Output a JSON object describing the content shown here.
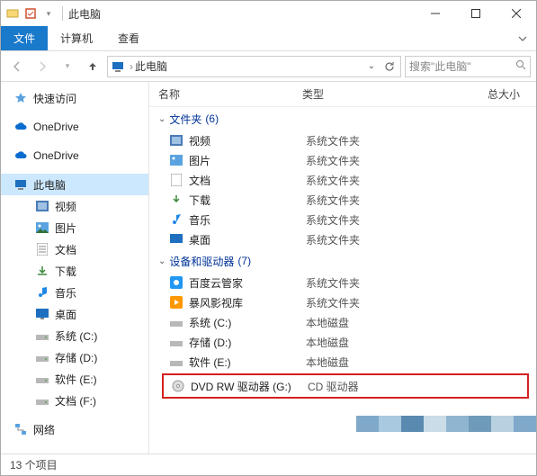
{
  "titlebar": {
    "title": "此电脑"
  },
  "ribbon": {
    "file": "文件",
    "computer": "计算机",
    "view": "查看"
  },
  "address": {
    "location": "此电脑"
  },
  "search": {
    "placeholder": "搜索\"此电脑\""
  },
  "sidebar": {
    "quick_access": "快速访问",
    "onedrive1": "OneDrive",
    "onedrive2": "OneDrive",
    "this_pc": "此电脑",
    "videos": "视频",
    "pictures": "图片",
    "documents": "文档",
    "downloads": "下载",
    "music": "音乐",
    "desktop": "桌面",
    "system_c": "系统 (C:)",
    "storage_d": "存储 (D:)",
    "software_e": "软件 (E:)",
    "docs_f": "文档 (F:)",
    "network": "网络"
  },
  "columns": {
    "name": "名称",
    "type": "类型",
    "size": "总大小"
  },
  "groups": {
    "folders": {
      "label": "文件夹",
      "count": "(6)"
    },
    "devices": {
      "label": "设备和驱动器",
      "count": "(7)"
    }
  },
  "types": {
    "sysfolder": "系统文件夹",
    "localdisk": "本地磁盘",
    "cddrive": "CD 驱动器"
  },
  "folder_items": {
    "videos": "视频",
    "pictures": "图片",
    "documents": "文档",
    "downloads": "下载",
    "music": "音乐",
    "desktop": "桌面"
  },
  "device_items": {
    "baidu": "百度云管家",
    "baofeng": "暴风影视库",
    "system_c": "系统 (C:)",
    "storage_d": "存储 (D:)",
    "software_e": "软件 (E:)",
    "dvd": "DVD RW 驱动器 (G:)"
  },
  "status": {
    "count": "13 个项目"
  }
}
